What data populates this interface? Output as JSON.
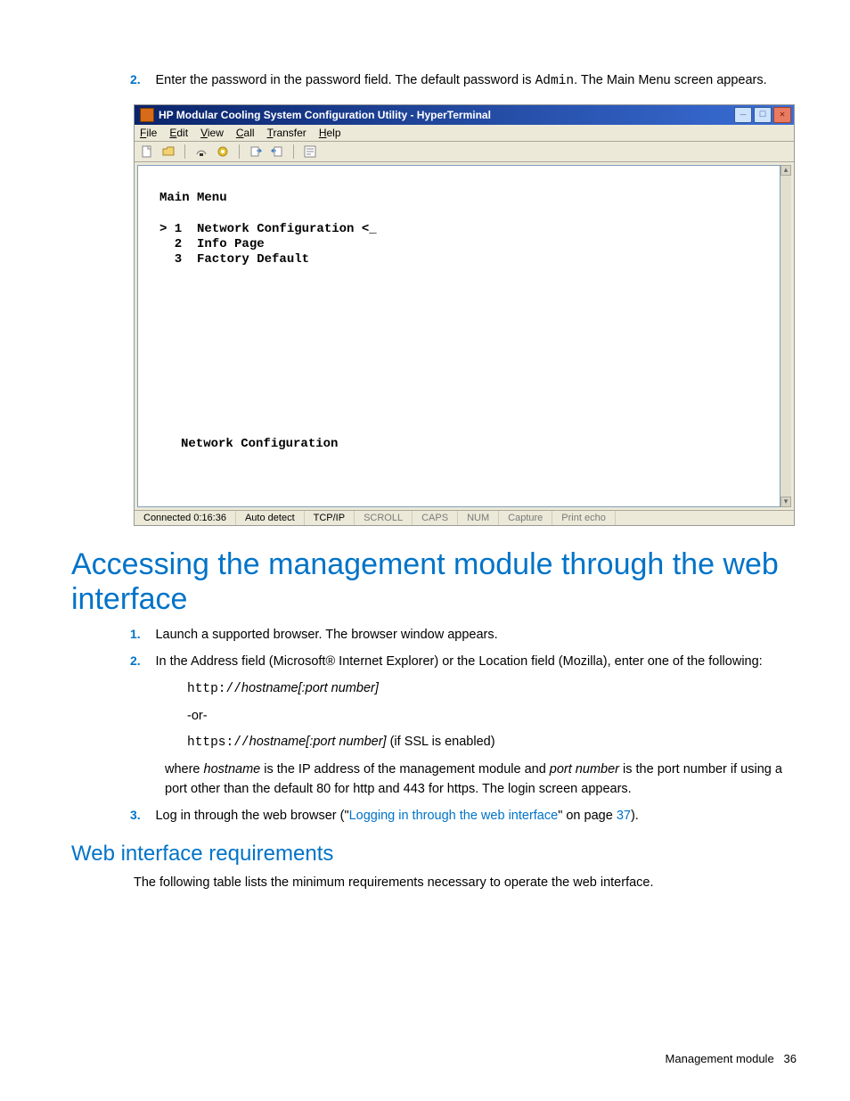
{
  "step2": {
    "num": "2.",
    "prefix": "Enter the password in the password field. The default password is ",
    "code": "Admin",
    "suffix": ".  The Main Menu screen appears."
  },
  "win": {
    "title": "HP Modular Cooling System Configuration Utility - HyperTerminal",
    "menus": {
      "file": "File",
      "edit": "Edit",
      "view": "View",
      "call": "Call",
      "transfer": "Transfer",
      "help": "Help"
    }
  },
  "terminal": {
    "title": "Main Menu",
    "item1": "> 1  Network Configuration <_",
    "item2": "  2  Info Page",
    "item3": "  3  Factory Default",
    "footer": "Network Configuration"
  },
  "status": {
    "conn": "Connected 0:16:36",
    "auto": "Auto detect",
    "proto": "TCP/IP",
    "scroll": "SCROLL",
    "caps": "CAPS",
    "num": "NUM",
    "capture": "Capture",
    "echo": "Print echo"
  },
  "h1": "Accessing the management module through the web interface",
  "s1": {
    "num": "1.",
    "text": "Launch a supported browser. The browser window appears."
  },
  "s2": {
    "num": "2.",
    "text": "In the Address field (Microsoft® Internet Explorer) or the Location field (Mozilla), enter one of the following:"
  },
  "url1": {
    "proto": "http://",
    "rest": "hostname[:port number]"
  },
  "or": "-or-",
  "url2": {
    "proto": "https://",
    "rest": "hostname[:port number]",
    "tail": " (if SSL is enabled)"
  },
  "where": {
    "p1": "where ",
    "hn": "hostname",
    "p2": " is the IP address of the management module and ",
    "pn": "port number",
    "p3": " is the port number if using a port other than the default 80 for http and 443 for https. The login screen appears."
  },
  "s3": {
    "num": "3.",
    "p1": "Log in through the web browser (\"",
    "link": "Logging in through the web interface",
    "p2": "\" on page ",
    "page": "37",
    "p3": ")."
  },
  "h2": "Web interface requirements",
  "req_intro": "The following table lists the minimum requirements necessary to operate the web interface.",
  "footer": {
    "label": "Management module",
    "page": "36"
  }
}
